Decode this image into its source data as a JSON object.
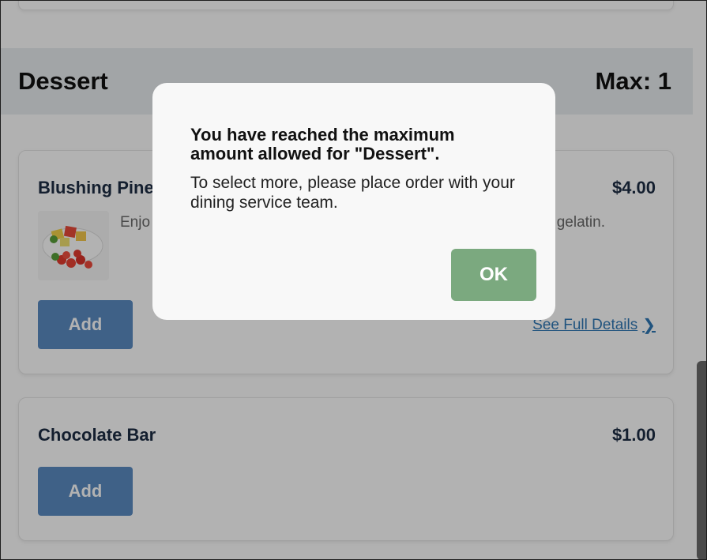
{
  "section": {
    "title": "Dessert",
    "max": "Max: 1"
  },
  "items": [
    {
      "name": "Blushing Pine",
      "price": "$4.00",
      "description_left": "Enjo",
      "description_right": "gelatin.",
      "add_label": "Add",
      "details_label": "See Full Details",
      "image_icon": "fruit-gelatin-thumbnail"
    },
    {
      "name": "Chocolate Bar",
      "price": "$1.00",
      "add_label": "Add"
    }
  ],
  "modal": {
    "title": "You have reached the maximum amount allowed for \"Dessert\".",
    "body": "To select more, please place order with your dining service team.",
    "ok_label": "OK"
  },
  "colors": {
    "add_button": "#5b8cc2",
    "ok_button": "#7ba97f",
    "link": "#2f77b5",
    "overlay": "rgba(0,0,0,0.3)"
  }
}
